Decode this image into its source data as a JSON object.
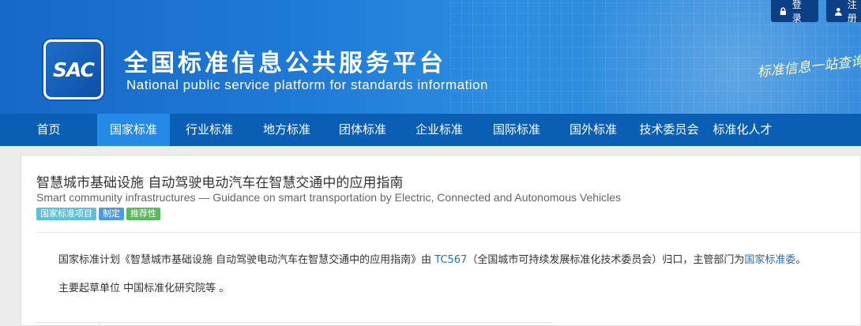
{
  "header": {
    "logo_text": "SAC",
    "title_cn": "全国标准信息公共服务平台",
    "title_en": "National public service platform  for standards information",
    "slogan": "标准信息一站查询",
    "login_label": "登录",
    "register_label": "注册"
  },
  "nav": {
    "items": [
      {
        "label": "首页"
      },
      {
        "label": "国家标准"
      },
      {
        "label": "行业标准"
      },
      {
        "label": "地方标准"
      },
      {
        "label": "团体标准"
      },
      {
        "label": "企业标准"
      },
      {
        "label": "国际标准"
      },
      {
        "label": "国外标准"
      },
      {
        "label": "技术委员会"
      },
      {
        "label": "标准化人才"
      }
    ],
    "active": "国家标准"
  },
  "standard": {
    "title_cn": "智慧城市基础设施 自动驾驶电动汽车在智慧交通中的应用指南",
    "title_en": "Smart community infrastructures — Guidance on smart transportation by Electric, Connected and Autonomous Vehicles",
    "badges": [
      {
        "label": "国家标准项目",
        "color": "#5bc0de"
      },
      {
        "label": "制定",
        "color": "#4b9be3"
      },
      {
        "label": "推荐性",
        "color": "#5cb85c"
      }
    ],
    "desc_prefix": "国家标准计划《智慧城市基础设施 自动驾驶电动汽车在智慧交通中的应用指南》由 ",
    "tc_link": "TC567",
    "desc_middle": "（全国城市可持续发展标准化技术委员会）归口，主管部门为",
    "dept_link": "国家标准委",
    "desc_suffix": "。",
    "drafting_unit": "主要起草单位 中国标准化研究院等 。"
  },
  "colors": {
    "header_blue": "#1f7ad6",
    "nav_blue": "#0a5fb4",
    "nav_active": "#2589e8",
    "link": "#2d6eb8"
  }
}
